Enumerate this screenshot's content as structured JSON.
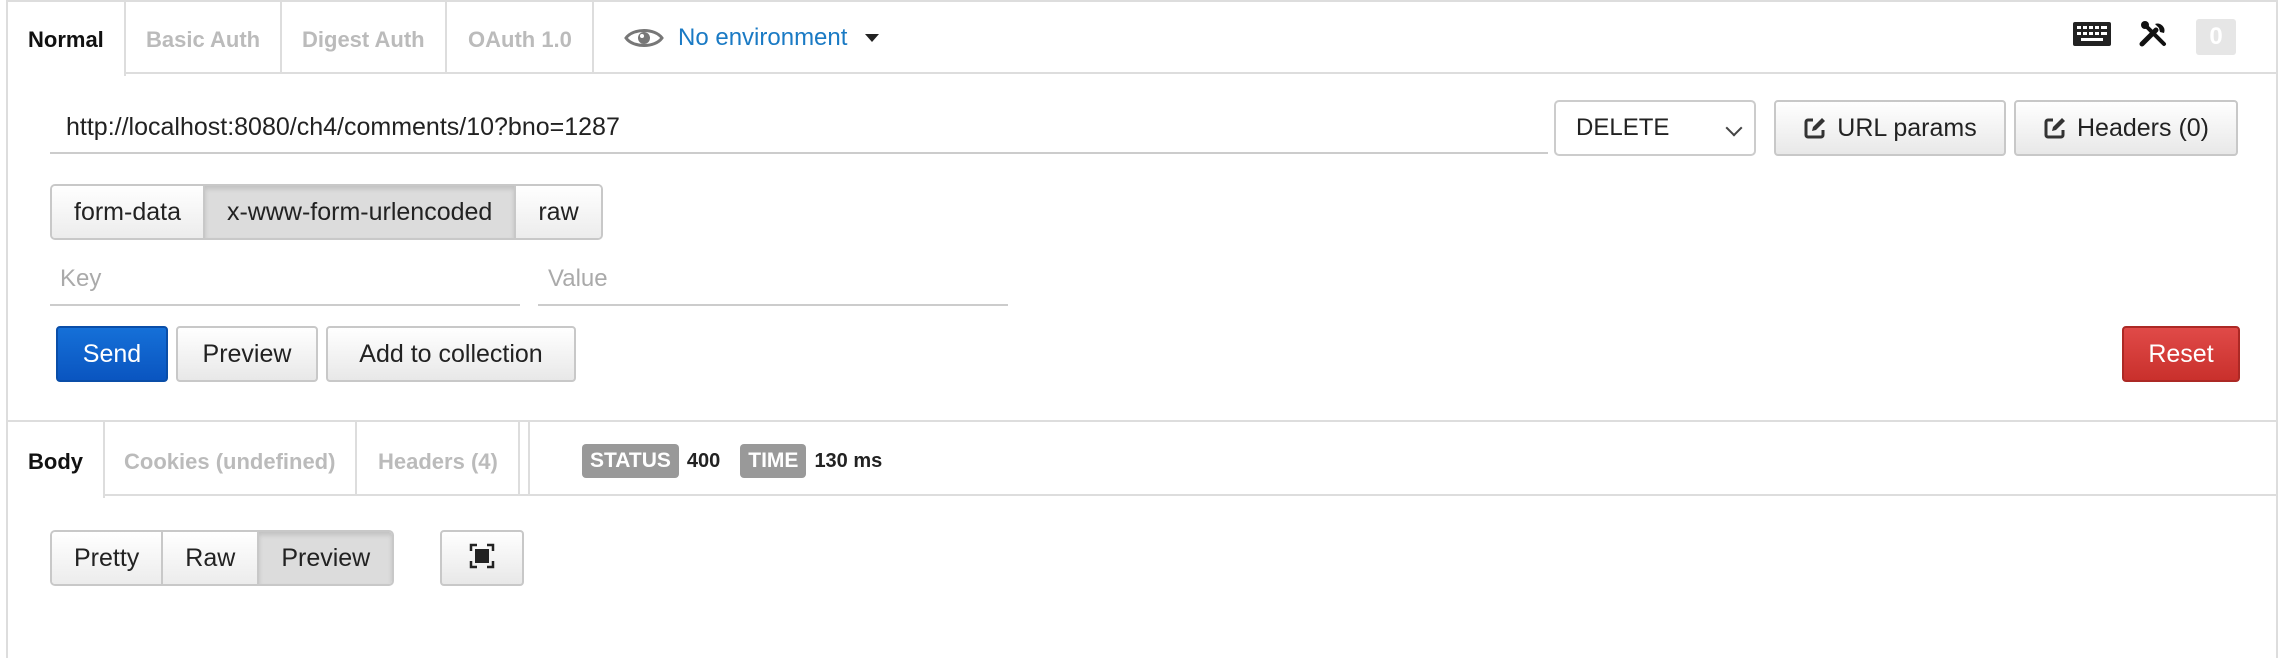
{
  "request_tabs": [
    {
      "label": "Normal",
      "active": true
    },
    {
      "label": "Basic Auth",
      "active": false
    },
    {
      "label": "Digest Auth",
      "active": false
    },
    {
      "label": "OAuth 1.0",
      "active": false
    }
  ],
  "environment": {
    "label": "No environment",
    "icon": "eye-icon"
  },
  "toolbar_icons": [
    "keyboard-icon",
    "wrench-icon"
  ],
  "history_count": "0",
  "url": {
    "value": "http://localhost:8080/ch4/comments/10?bno=1287"
  },
  "method": {
    "selected": "DELETE"
  },
  "url_params_label": "URL params",
  "headers_label": "Headers (0)",
  "body_types": [
    {
      "label": "form-data",
      "active": false
    },
    {
      "label": "x-www-form-urlencoded",
      "active": true
    },
    {
      "label": "raw",
      "active": false
    }
  ],
  "kv": {
    "key_placeholder": "Key",
    "value_placeholder": "Value"
  },
  "actions": {
    "send": "Send",
    "preview": "Preview",
    "add_to_collection": "Add to collection",
    "reset": "Reset"
  },
  "response_tabs": [
    {
      "label": "Body",
      "active": true
    },
    {
      "label": "Cookies (undefined)",
      "active": false
    },
    {
      "label": "Headers (4)",
      "active": false
    }
  ],
  "status": {
    "label": "STATUS",
    "value": "400"
  },
  "time": {
    "label": "TIME",
    "value": "130 ms"
  },
  "view_modes": [
    {
      "label": "Pretty",
      "active": false
    },
    {
      "label": "Raw",
      "active": false
    },
    {
      "label": "Preview",
      "active": true
    }
  ],
  "colors": {
    "link": "#1a7ac4",
    "send": "#0a55c0",
    "reset": "#c9302c",
    "badge": "#999999"
  }
}
